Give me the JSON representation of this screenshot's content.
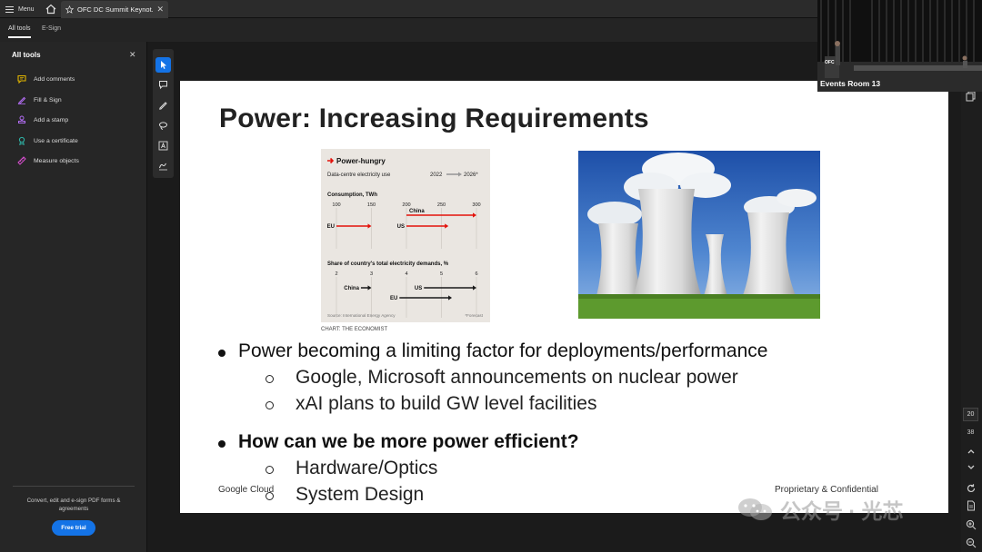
{
  "app": {
    "menu_label": "Menu",
    "tab_title": "OFC DC Summit Keynot...",
    "tab_close": "✕",
    "tools_tabs": [
      "All tools",
      "E-Sign"
    ]
  },
  "left_panel": {
    "title": "All tools",
    "close": "✕",
    "items": [
      {
        "label": "Add comments",
        "icon": "comment-icon",
        "color": "#e0b400"
      },
      {
        "label": "Fill & Sign",
        "icon": "pen-sign-icon",
        "color": "#b06cf0"
      },
      {
        "label": "Add a stamp",
        "icon": "stamp-icon",
        "color": "#b06cf0"
      },
      {
        "label": "Use a certificate",
        "icon": "certificate-icon",
        "color": "#2fb5a8"
      },
      {
        "label": "Measure objects",
        "icon": "ruler-icon",
        "color": "#d84fd0"
      }
    ],
    "promo_text": "Convert, edit and e-sign PDF forms & agreements",
    "free_trial_label": "Free trial",
    "accent": "#1473e6"
  },
  "slide": {
    "title": "Power: Increasing Requirements",
    "chart_credit": "CHART: THE ECONOMIST",
    "bullets": [
      {
        "text": "Power becoming a limiting factor for deployments/performance",
        "bold": false,
        "sub": [
          "Google, Microsoft announcements on nuclear power",
          "xAI plans to build GW level facilities"
        ]
      },
      {
        "text": "How can we be more power efficient?",
        "bold": true,
        "sub": [
          "Hardware/Optics",
          "System Design"
        ]
      }
    ],
    "footer_left": "Google Cloud",
    "footer_right": "Proprietary & Confidential"
  },
  "chart_data": {
    "type": "bar",
    "title": "Power-hungry",
    "subtitle": "Data-centre electricity use",
    "legend": [
      "2022",
      "2026*"
    ],
    "panels": [
      {
        "label": "Consumption, TWh",
        "ticks": [
          100,
          150,
          200,
          250,
          300
        ],
        "series": [
          {
            "name": "EU",
            "from": 100,
            "to": 150
          },
          {
            "name": "US",
            "from": 200,
            "to": 260
          },
          {
            "name": "China",
            "from": 200,
            "to": 300
          }
        ]
      },
      {
        "label": "Share of country's total electricity demands, %",
        "ticks": [
          2,
          3,
          4,
          5,
          6
        ],
        "series": [
          {
            "name": "China",
            "from": 2.7,
            "to": 3.0
          },
          {
            "name": "US",
            "from": 4.5,
            "to": 6.0
          },
          {
            "name": "EU",
            "from": 3.8,
            "to": 5.3
          }
        ]
      }
    ],
    "source": "Source: International Energy Agency",
    "footnote": "*Forecast",
    "colors": {
      "highlight": "#e3120b",
      "dark": "#1a1a1a",
      "background": "#eae6e1"
    }
  },
  "right_rail": {
    "page_current": "20",
    "page_total": "38"
  },
  "video": {
    "label": "Events Room 13",
    "stage_text": "OFC"
  },
  "watermark": {
    "text": "公众号 · 光芯"
  }
}
